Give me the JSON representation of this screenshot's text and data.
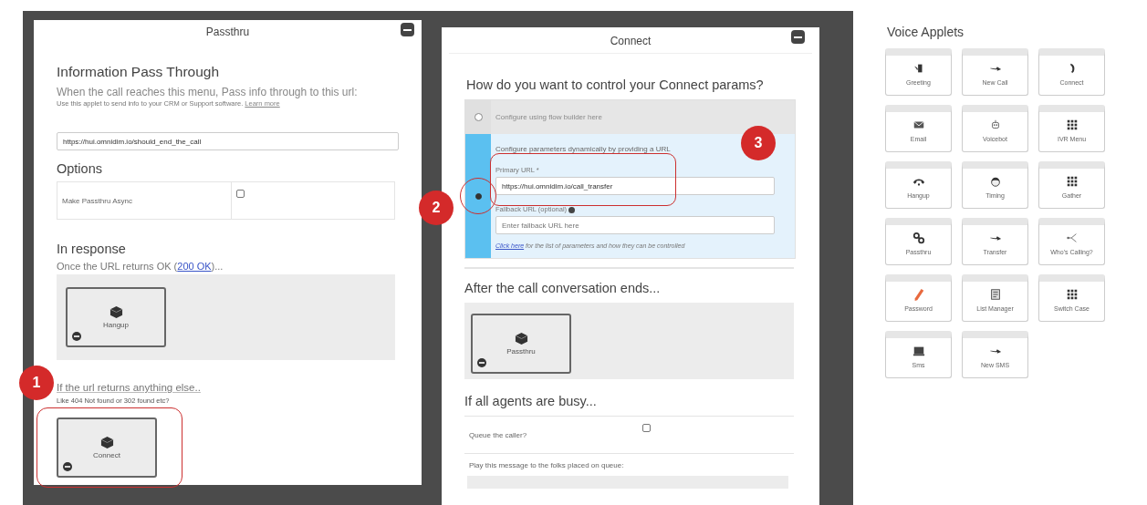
{
  "passthru_panel": {
    "title": "Passthru",
    "heading": "Information Pass Through",
    "description": "When the call reaches this menu, Pass info through to this url:",
    "hint": "Use this applet to send info to your CRM or Support software.",
    "hint_link": "Learn more",
    "url": "https://hui.omnidim.io/should_end_the_call",
    "options_heading": "Options",
    "options": [
      {
        "label": "Make Passthru Async",
        "checked": false
      }
    ],
    "response_heading": "In response",
    "ok_text": "Once the URL returns OK (",
    "ok_link": "200 OK",
    "ok_text_after": ")...",
    "ok_applet": "Hangup",
    "else_heading": "If the url returns anything else..",
    "else_hint": "Like 404 Not found or 302 found etc?",
    "else_applet": "Connect"
  },
  "connect_panel": {
    "title": "Connect",
    "question": "How do you want to control your Connect params?",
    "modes": [
      {
        "kind": "static",
        "label": "Configure using flow builder here",
        "selected": false
      },
      {
        "kind": "dynamic",
        "label": "Configure parameters dynamically by providing a URL",
        "selected": true,
        "primary_label": "Primary URL *",
        "primary_value": "https://hui.omnidim.io/call_transfer",
        "fallback_label": "Fallback URL (optional)",
        "fallback_placeholder": "Enter fallback URL here",
        "link": "Click here",
        "link_after": "for the list of parameters and how they can be controlled"
      }
    ],
    "after_heading": "After the call conversation ends...",
    "after_applet": "Passthru",
    "busy_heading": "If all agents are busy...",
    "busy_options": [
      {
        "label": "Queue the caller?",
        "checked": false
      }
    ],
    "queue_message_label": "Play this message to the folks placed on queue:"
  },
  "voice_applets": {
    "title": "Voice Applets",
    "items": [
      {
        "label": "Greeting",
        "kind": "speaker"
      },
      {
        "label": "New Call",
        "kind": "arrow"
      },
      {
        "label": "Connect",
        "kind": "phone"
      },
      {
        "label": "Email",
        "kind": "envelope"
      },
      {
        "label": "Voicebot",
        "kind": "robot"
      },
      {
        "label": "IVR Menu",
        "kind": "keypad"
      },
      {
        "label": "Hangup",
        "kind": "hangup"
      },
      {
        "label": "Timing",
        "kind": "head"
      },
      {
        "label": "Gather",
        "kind": "keypad"
      },
      {
        "label": "Passthru",
        "kind": "chain"
      },
      {
        "label": "Transfer",
        "kind": "arrow"
      },
      {
        "label": "Who's Calling?",
        "kind": "branch"
      },
      {
        "label": "Password",
        "kind": "pencil"
      },
      {
        "label": "List Manager",
        "kind": "document"
      },
      {
        "label": "Switch Case",
        "kind": "keypad"
      },
      {
        "label": "Sms",
        "kind": "laptop"
      },
      {
        "label": "New SMS",
        "kind": "arrow"
      }
    ]
  },
  "annotations": [
    {
      "label": "1"
    },
    {
      "label": "2"
    },
    {
      "label": "3"
    }
  ]
}
